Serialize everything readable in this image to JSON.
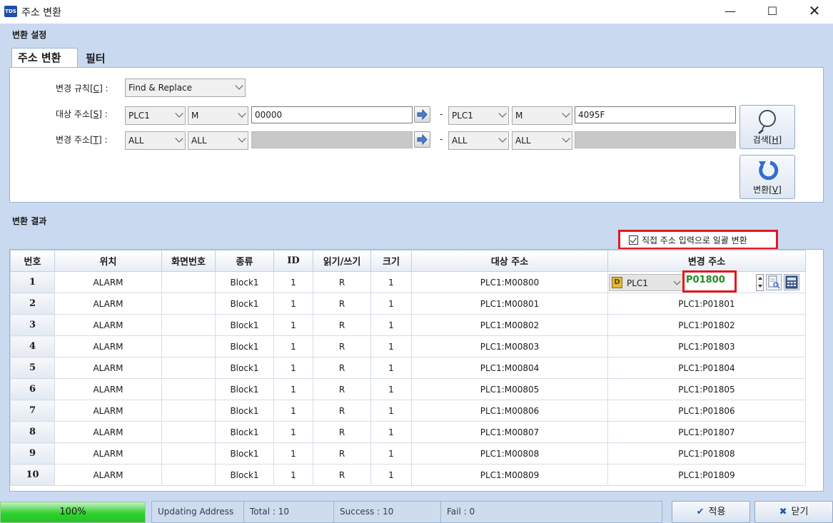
{
  "window": {
    "icon_text": "TDS",
    "title": "주소 변환",
    "minimize": "—",
    "maximize": "☐",
    "close": "✕"
  },
  "settings": {
    "group_label": "변환 설정",
    "tabs": [
      {
        "label": "주소 변환",
        "active": true
      },
      {
        "label": "필터",
        "active": false
      }
    ],
    "rule": {
      "label_prefix": "변경 규칙[",
      "label_key": "C",
      "label_suffix": "] :",
      "value": "Find & Replace"
    },
    "target": {
      "label_prefix": "대상 주소[",
      "label_key": "S",
      "label_suffix": "] :",
      "from_device": "PLC1",
      "from_area": "M",
      "from_value": "00000",
      "to_device": "PLC1",
      "to_area": "M",
      "to_value": "4095F"
    },
    "change": {
      "label_prefix": "변경 주소[",
      "label_key": "T",
      "label_suffix": "] :",
      "from_device": "ALL",
      "from_area": "ALL",
      "from_value": "",
      "to_device": "ALL",
      "to_area": "ALL",
      "to_value": ""
    },
    "dash": "-",
    "search_button": {
      "label_prefix": "검색[",
      "label_key": "H",
      "label_suffix": "]"
    },
    "convert_button": {
      "label_prefix": "변환[",
      "label_key": "V",
      "label_suffix": "]"
    }
  },
  "results": {
    "group_label": "변환 결과",
    "direct_input_checkbox": {
      "label": "직접 주소 입력으로 일괄 변환",
      "checked": true
    },
    "columns": [
      "번호",
      "위치",
      "화면번호",
      "종류",
      "ID",
      "읽기/쓰기",
      "크기",
      "대상 주소",
      "변경 주소"
    ],
    "rows": [
      {
        "num": "1",
        "location": "ALARM",
        "screen": "",
        "type": "Block1",
        "id": "1",
        "rw": "R",
        "size": "1",
        "target": "PLC1:M00800",
        "change": ""
      },
      {
        "num": "2",
        "location": "ALARM",
        "screen": "",
        "type": "Block1",
        "id": "1",
        "rw": "R",
        "size": "1",
        "target": "PLC1:M00801",
        "change": "PLC1:P01801"
      },
      {
        "num": "3",
        "location": "ALARM",
        "screen": "",
        "type": "Block1",
        "id": "1",
        "rw": "R",
        "size": "1",
        "target": "PLC1:M00802",
        "change": "PLC1:P01802"
      },
      {
        "num": "4",
        "location": "ALARM",
        "screen": "",
        "type": "Block1",
        "id": "1",
        "rw": "R",
        "size": "1",
        "target": "PLC1:M00803",
        "change": "PLC1:P01803"
      },
      {
        "num": "5",
        "location": "ALARM",
        "screen": "",
        "type": "Block1",
        "id": "1",
        "rw": "R",
        "size": "1",
        "target": "PLC1:M00804",
        "change": "PLC1:P01804"
      },
      {
        "num": "6",
        "location": "ALARM",
        "screen": "",
        "type": "Block1",
        "id": "1",
        "rw": "R",
        "size": "1",
        "target": "PLC1:M00805",
        "change": "PLC1:P01805"
      },
      {
        "num": "7",
        "location": "ALARM",
        "screen": "",
        "type": "Block1",
        "id": "1",
        "rw": "R",
        "size": "1",
        "target": "PLC1:M00806",
        "change": "PLC1:P01806"
      },
      {
        "num": "8",
        "location": "ALARM",
        "screen": "",
        "type": "Block1",
        "id": "1",
        "rw": "R",
        "size": "1",
        "target": "PLC1:M00807",
        "change": "PLC1:P01807"
      },
      {
        "num": "9",
        "location": "ALARM",
        "screen": "",
        "type": "Block1",
        "id": "1",
        "rw": "R",
        "size": "1",
        "target": "PLC1:M00808",
        "change": "PLC1:P01808"
      },
      {
        "num": "10",
        "location": "ALARM",
        "screen": "",
        "type": "Block1",
        "id": "1",
        "rw": "R",
        "size": "1",
        "target": "PLC1:M00809",
        "change": "PLC1:P01809"
      }
    ],
    "editor": {
      "device_icon": "D",
      "device": "PLC1",
      "value": "P01800"
    }
  },
  "status": {
    "progress_text": "100%",
    "progress": 1.0,
    "message": "Updating Address",
    "total": "Total : 10",
    "success": "Success : 10",
    "fail": "Fail : 0"
  },
  "footer": {
    "apply_icon": "✔",
    "apply_label": "적용",
    "close_icon": "✖",
    "close_label": "닫기"
  },
  "colors": {
    "highlight_border": "#e0191e",
    "panel_bg": "#c9d9ef",
    "progress_green": "#2fd12f",
    "edit_value_green": "#1f8b1f"
  }
}
